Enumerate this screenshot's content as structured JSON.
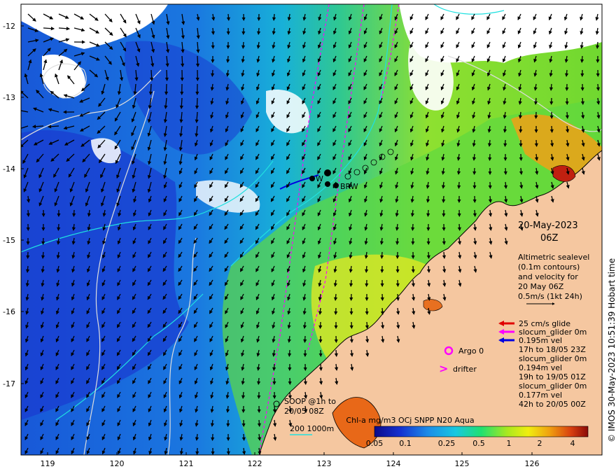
{
  "map": {
    "y_ticks": [
      "-12",
      "-13",
      "-14",
      "-15",
      "-16",
      "-17"
    ],
    "x_ticks": [
      "119",
      "120",
      "121",
      "122",
      "123",
      "124",
      "125",
      "126"
    ],
    "date": "20-May-2023",
    "time": "06Z",
    "info_lines": [
      "Altimetric sealevel",
      "(0.1m contours)",
      "and velocity for",
      "20 May 06Z",
      "0.5m/s (1kt 24h)"
    ],
    "copyright": "© IMOS 30-May-2023 10:51:39 Hobart time",
    "legend": {
      "items": [
        {
          "label": "25 cm/s glide",
          "color": "#e00000"
        },
        {
          "label": "slocum_glider 0m",
          "color": "#ff00ff"
        },
        {
          "label": "0.195m vel",
          "color": "#0000e0"
        }
      ],
      "extra_lines": [
        "17h to 18/05 23Z",
        "slocum_glider 0m",
        "0.194m vel",
        "19h to 19/05 01Z",
        "slocum_glider 0m",
        "0.177m vel",
        "42h to 20/05 00Z"
      ],
      "argo": "Argo 0",
      "drifter": "drifter"
    },
    "mooring_labels": [
      "W",
      "BRW"
    ],
    "soop_lines": [
      "SOOP @1h to",
      "20/05 08Z"
    ],
    "depth_legend": "200  1000m",
    "colorbar": {
      "title": "Chl-a mg/m3 OCj SNPP N20 Aqua",
      "ticks": [
        "0.05",
        "0.1",
        "0.25",
        "0.5",
        "1",
        "2",
        "4"
      ]
    },
    "colors": {
      "land": "#f5c7a0",
      "arrow": "#000000",
      "magenta": "#ff00ff"
    }
  }
}
